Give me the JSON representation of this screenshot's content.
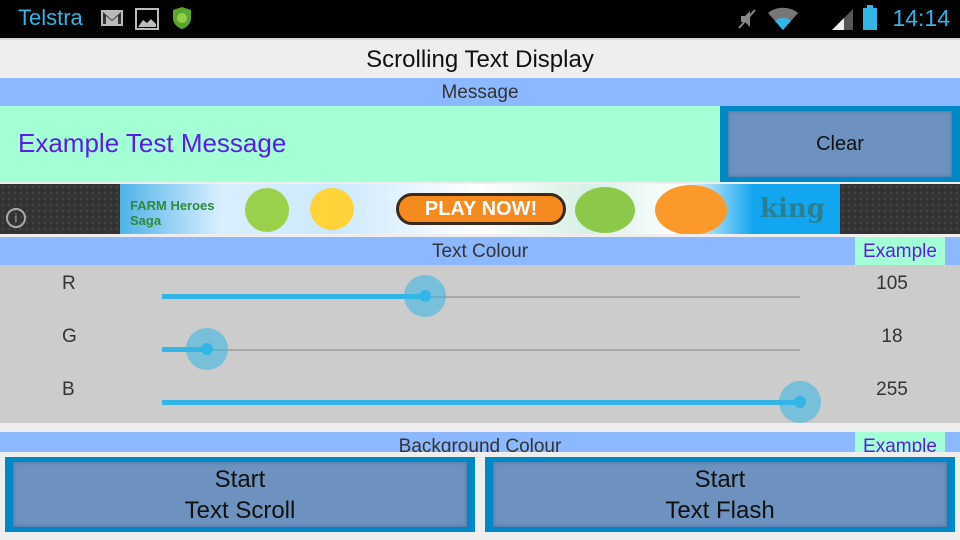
{
  "status_bar": {
    "carrier": "Telstra",
    "left_icons": [
      "gmail-icon",
      "gallery-icon",
      "app-badge-icon"
    ],
    "right_icons": [
      "mute-icon",
      "wifi-icon",
      "signal-icon",
      "battery-icon"
    ],
    "time": "14:14"
  },
  "app": {
    "title": "Scrolling Text Display"
  },
  "message_section": {
    "header": "Message",
    "message_text": "Example Test Message",
    "clear_label": "Clear"
  },
  "ad": {
    "texts": [
      "FARM Heroes Saga",
      "PLAY NOW!",
      "king"
    ],
    "info_icon": "i"
  },
  "text_colour": {
    "header": "Text Colour",
    "example_label": "Example",
    "channels": [
      {
        "label": "R",
        "value": 105,
        "value_text": "105"
      },
      {
        "label": "G",
        "value": 18,
        "value_text": "18"
      },
      {
        "label": "B",
        "value": 255,
        "value_text": "255"
      }
    ],
    "max": 255
  },
  "background_colour": {
    "header": "Background Colour",
    "example_label": "Example"
  },
  "buttons": {
    "start_scroll_line1": "Start",
    "start_scroll_line2": "Text Scroll",
    "start_flash_line1": "Start",
    "start_flash_line2": "Text Flash"
  },
  "colors": {
    "accent": "#33b5e5",
    "header_bg": "#8cb8ff",
    "example_bg": "#a4ffd4",
    "example_text": "#5c1de6",
    "button_border": "#0088c6",
    "button_fill": "#6e92bf"
  }
}
